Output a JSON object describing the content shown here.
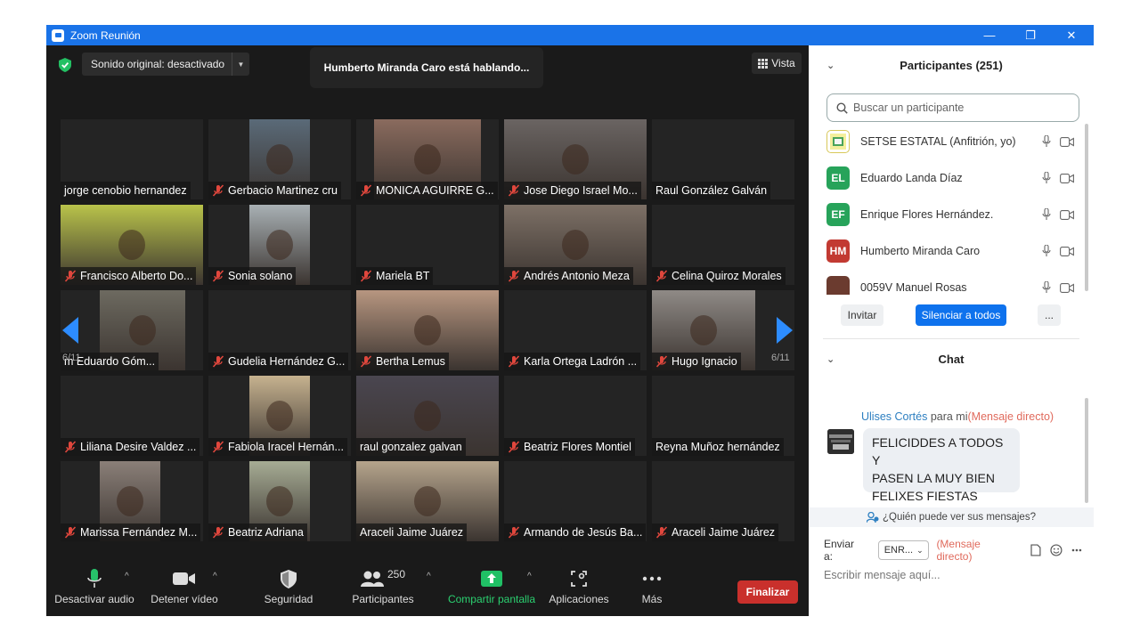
{
  "window": {
    "title": "Zoom Reunión",
    "controls": {
      "minimize": "—",
      "restore": "❐",
      "close": "✕"
    }
  },
  "meeting": {
    "audio_option": "Sonido original: desactivado",
    "speaking_banner": "Humberto Miranda Caro está hablando...",
    "view_label": "Vista",
    "page_left": "6/11",
    "page_right": "6/11",
    "tiles": [
      {
        "name": "jorge cenobio hernandez",
        "muted": false,
        "video": false
      },
      {
        "name": "Gerbacio Martinez cru",
        "muted": true,
        "video": true,
        "vcolor": "#5a6a78"
      },
      {
        "name": "MONICA AGUIRRE G...",
        "muted": true,
        "video": true,
        "vcolor": "#8a6b5e"
      },
      {
        "name": "Jose Diego Israel Mo...",
        "muted": true,
        "video": true,
        "vcolor": "#6a6462"
      },
      {
        "name": "Raul González Galván",
        "muted": false,
        "video": false
      },
      {
        "name": "Francisco Alberto Do...",
        "muted": true,
        "video": true,
        "vcolor": "#b9c34a"
      },
      {
        "name": "Sonia solano",
        "muted": true,
        "video": true,
        "vcolor": "#a8b0b4"
      },
      {
        "name": "Mariela BT",
        "muted": true,
        "video": false
      },
      {
        "name": "Andrés Antonio Meza",
        "muted": true,
        "video": true,
        "vcolor": "#7d7066"
      },
      {
        "name": "Celina Quiroz Morales",
        "muted": true,
        "video": false
      },
      {
        "name": "m Eduardo Góm...",
        "muted": false,
        "video": true,
        "vcolor": "#6d6a60"
      },
      {
        "name": "Gudelia Hernández G...",
        "muted": true,
        "video": false
      },
      {
        "name": "Bertha Lemus",
        "muted": true,
        "video": true,
        "vcolor": "#b79680"
      },
      {
        "name": "Karla Ortega Ladrón ...",
        "muted": true,
        "video": false
      },
      {
        "name": "Hugo Ignacio",
        "muted": true,
        "video": true,
        "vcolor": "#8f8a86"
      },
      {
        "name": "Liliana Desire Valdez ...",
        "muted": true,
        "video": false
      },
      {
        "name": "Fabiola Iracel Hernán...",
        "muted": true,
        "video": true,
        "vcolor": "#c6b28f"
      },
      {
        "name": "raul gonzalez galvan",
        "muted": false,
        "video": true,
        "vcolor": "#4a4650"
      },
      {
        "name": "Beatriz Flores Montiel",
        "muted": true,
        "video": false
      },
      {
        "name": "Reyna Muñoz hernández",
        "muted": false,
        "video": false
      },
      {
        "name": "Marissa Fernández M...",
        "muted": true,
        "video": true,
        "vcolor": "#8a7f78"
      },
      {
        "name": "Beatriz Adriana",
        "muted": true,
        "video": true,
        "vcolor": "#a6ac94"
      },
      {
        "name": "Araceli Jaime Juárez",
        "muted": false,
        "video": true,
        "vcolor": "#b5a48c"
      },
      {
        "name": "Armando de Jesús Ba...",
        "muted": true,
        "video": false
      },
      {
        "name": "Araceli Jaime Juárez",
        "muted": true,
        "video": false
      }
    ]
  },
  "toolbar": {
    "audio": "Desactivar audio",
    "video": "Detener vídeo",
    "security": "Seguridad",
    "participants": "Participantes",
    "participants_count": "250",
    "share": "Compartir pantalla",
    "apps": "Aplicaciones",
    "more": "Más",
    "end": "Finalizar"
  },
  "participants_panel": {
    "title": "Participantes (251)",
    "search_placeholder": "Buscar un participante",
    "rows": [
      {
        "initials": "",
        "name": "SETSE ESTATAL (Anfitrión, yo)",
        "color": "#ffffff"
      },
      {
        "initials": "EL",
        "name": "Eduardo Landa Díaz",
        "color": "#27a35a"
      },
      {
        "initials": "EF",
        "name": "Enrique Flores Hernández.",
        "color": "#27a35a"
      },
      {
        "initials": "HM",
        "name": "Humberto Miranda Caro",
        "color": "#c23a32"
      },
      {
        "initials": "",
        "name": "0059V Manuel Rosas",
        "color": "#6b3b2f"
      }
    ],
    "invite": "Invitar",
    "mute_all": "Silenciar a todos",
    "more": "..."
  },
  "chat": {
    "title": "Chat",
    "sender": "Ulises Cortés",
    "for_me": "para mi",
    "direct": "(Mensaje directo)",
    "message_lines": [
      "FELICIDDES A TODOS Y",
      "PASEN LA MUY BIEN",
      "FELIXES FIESTAS"
    ],
    "who_sees": "¿Quién puede ver sus mensajes?",
    "send_to_label": "Enviar a:",
    "send_to_value": "ENR...",
    "send_to_mode": "(Mensaje directo)",
    "input_placeholder": "Escribir mensaje aquí..."
  },
  "colors": {
    "titlebar": "#1a73e8",
    "accent_blue": "#0e72ed",
    "end_red": "#c9302c",
    "share_green": "#20c065",
    "mute_red": "#e0473d",
    "direct_red": "#e06a5c",
    "sender_blue": "#2d7fc1"
  }
}
